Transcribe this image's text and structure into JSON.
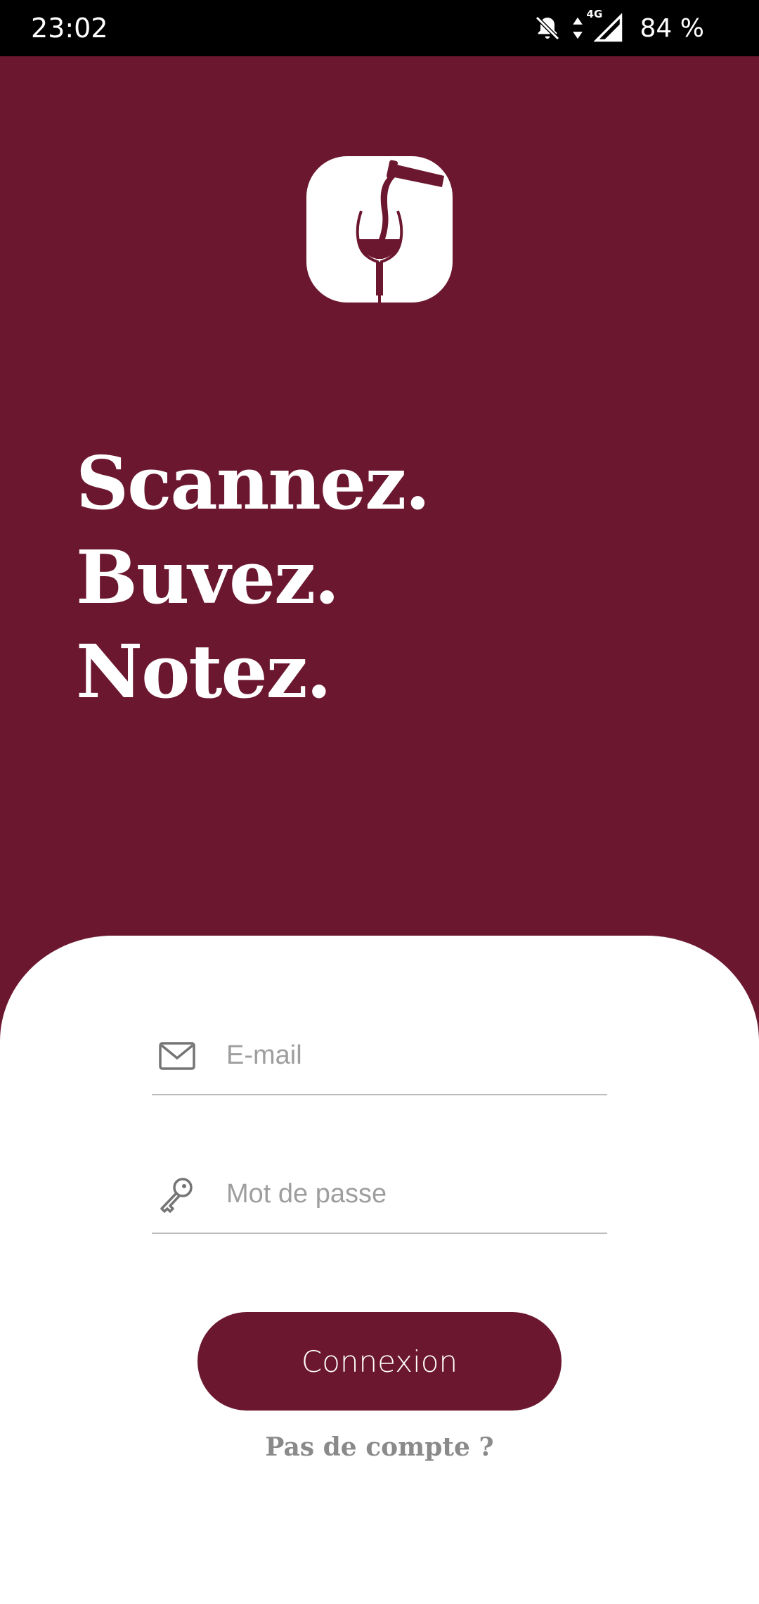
{
  "status_bar": {
    "time": "23:02",
    "network": "4G",
    "battery": "84 %",
    "icons": [
      "bell-off-icon",
      "data-arrows-icon",
      "signal-icon"
    ]
  },
  "logo": {
    "icon": "wine-pour-logo"
  },
  "slogan": {
    "line1": "Scannez.",
    "line2": "Buvez.",
    "line3": "Notez."
  },
  "login_form": {
    "email": {
      "icon": "mail-icon",
      "placeholder": "E-mail",
      "value": ""
    },
    "password": {
      "icon": "key-icon",
      "placeholder": "Mot de passe",
      "value": ""
    },
    "submit_label": "Connexion",
    "signup_link": "Pas de compte ?"
  },
  "colors": {
    "brand": "#6c1730",
    "sheet": "#ffffff",
    "placeholder": "#9e9e9e",
    "link": "#8a8a8a"
  }
}
